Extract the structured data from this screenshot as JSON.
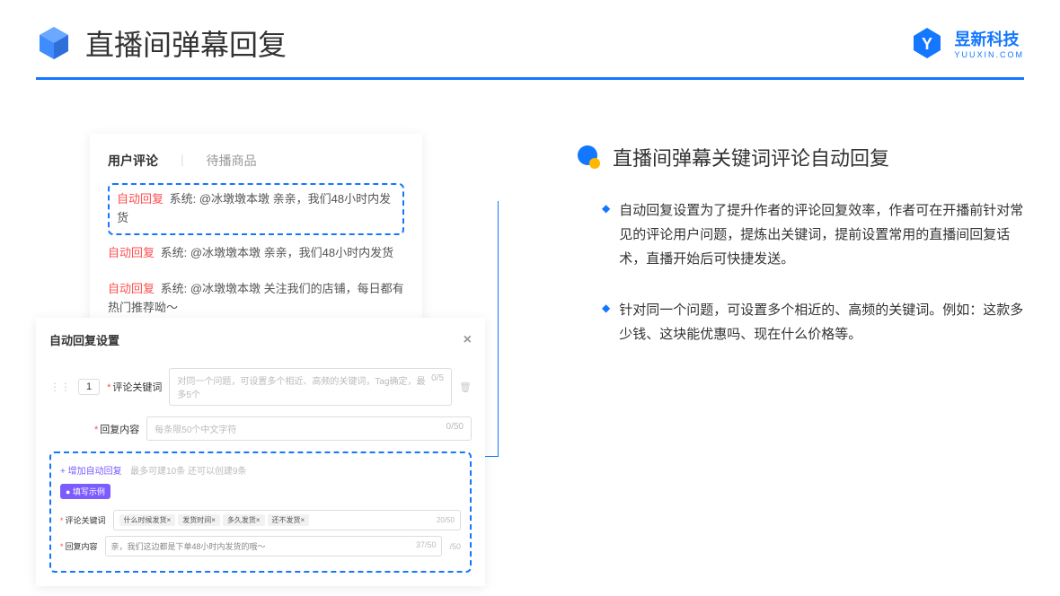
{
  "header": {
    "title": "直播间弹幕回复",
    "brand_main": "昱新科技",
    "brand_sub": "YUUXIN.COM"
  },
  "comments": {
    "tab_active": "用户评论",
    "tab_inactive": "待播商品",
    "rows": [
      {
        "auto": "自动回复",
        "text": "系统: @冰墩墩本墩 亲亲，我们48小时内发货"
      },
      {
        "auto": "自动回复",
        "text": "系统: @冰墩墩本墩 亲亲，我们48小时内发货"
      },
      {
        "auto": "自动回复",
        "text": "系统: @冰墩墩本墩 关注我们的店铺，每日都有热门推荐呦～"
      }
    ]
  },
  "settings": {
    "title": "自动回复设置",
    "row_num": "1",
    "keyword_label": "评论关键词",
    "keyword_placeholder": "对同一个问题，可设置多个相近、高频的关键词，Tag确定，最多5个",
    "keyword_counter": "0/5",
    "content_label": "回复内容",
    "content_placeholder": "每条限50个中文字符",
    "content_counter": "0/50",
    "add_text": "+ 增加自动回复",
    "add_hint": "最多可建10条 还可以创建9条",
    "example_badge": "● 填写示例",
    "ex_keyword_label": "评论关键词",
    "ex_tags": [
      "什么时候发货×",
      "发货时间×",
      "多久发货×",
      "还不发货×"
    ],
    "ex_keyword_counter": "20/50",
    "ex_content_label": "回复内容",
    "ex_content_text": "亲，我们这边都是下单48小时内发货的哦～",
    "ex_content_counter": "37/50",
    "outer_counter": "/50"
  },
  "right": {
    "section_title": "直播间弹幕关键词评论自动回复",
    "bullets": [
      "自动回复设置为了提升作者的评论回复效率，作者可在开播前针对常见的评论用户问题，提炼出关键词，提前设置常用的直播间回复话术，直播开始后可快捷发送。",
      "针对同一个问题，可设置多个相近的、高频的关键词。例如：这款多少钱、这块能优惠吗、现在什么价格等。"
    ]
  }
}
